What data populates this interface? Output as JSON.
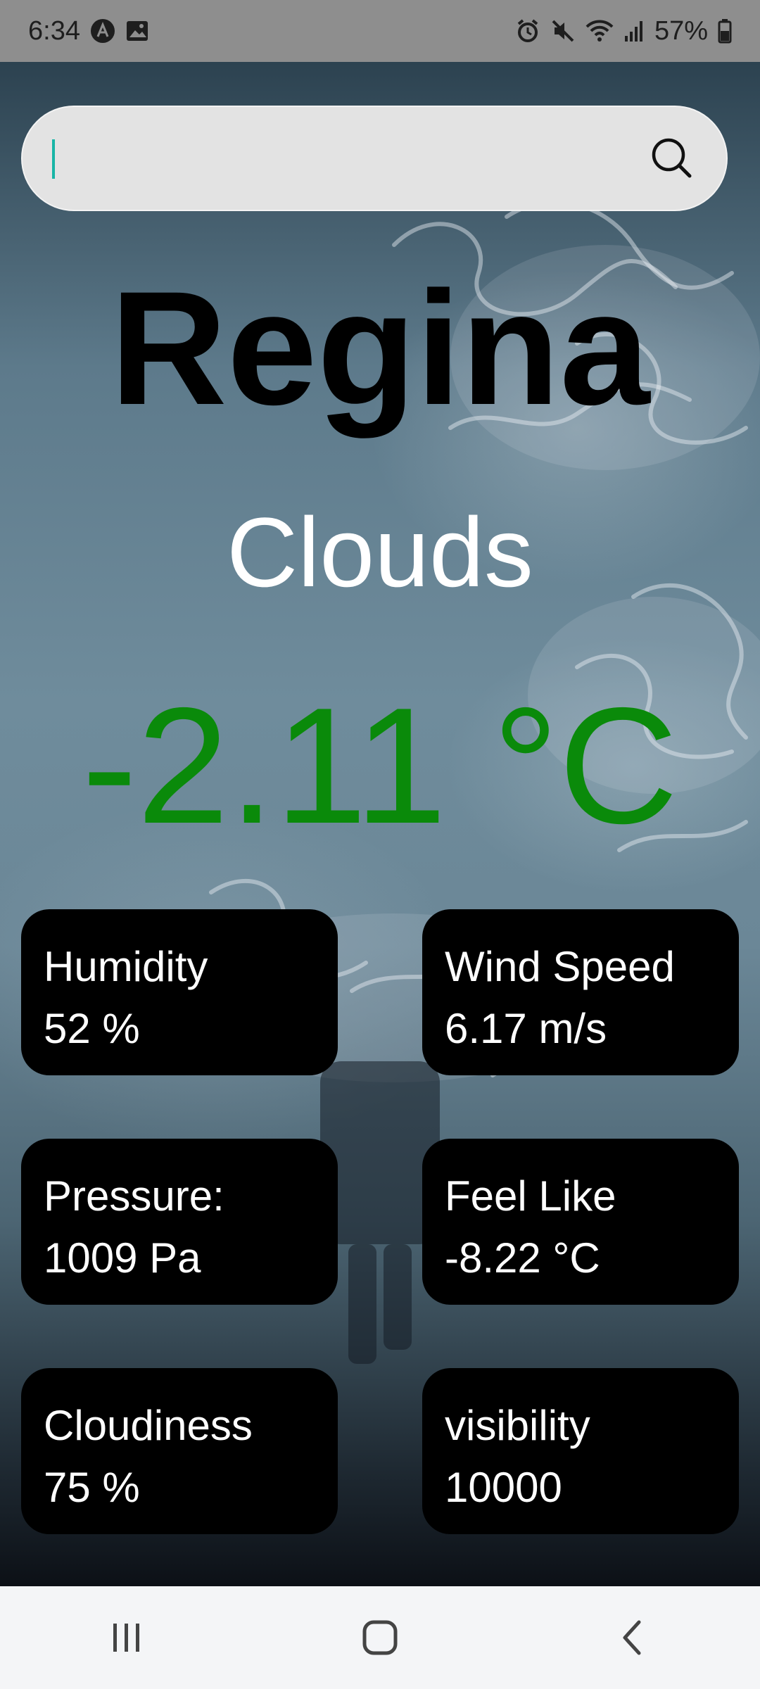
{
  "status_bar": {
    "time": "6:34",
    "battery": "57%",
    "icons": [
      "app-a-icon",
      "image-icon",
      "alarm-icon",
      "mute-icon",
      "wifi-icon",
      "signal-icon",
      "battery-icon"
    ]
  },
  "search": {
    "value": "",
    "placeholder": "",
    "icon": "search-icon"
  },
  "weather": {
    "city": "Regina",
    "condition": "Clouds",
    "temperature": "-2.11 °C"
  },
  "cards": [
    {
      "label": "Humidity",
      "value": "52 %"
    },
    {
      "label": "Wind Speed",
      "value": "6.17 m/s"
    },
    {
      "label": "Pressure:",
      "value": "1009 Pa"
    },
    {
      "label": "Feel Like",
      "value": "-8.22 °C"
    },
    {
      "label": "Cloudiness",
      "value": "75 %"
    },
    {
      "label": "visibility",
      "value": "10000"
    }
  ],
  "nav_bar": {
    "buttons": [
      "recents-icon",
      "home-icon",
      "back-icon"
    ]
  },
  "colors": {
    "temperature": "#0a8a0a",
    "card_bg": "#000000",
    "caret": "#18b5a6",
    "search_bg": "#e3e3e3"
  }
}
